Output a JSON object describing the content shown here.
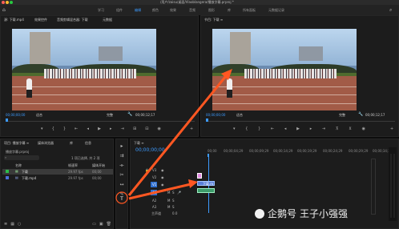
{
  "window": {
    "title": "/用户/zaisu/桌面/Vlaoblangera/播放字幕.prproj *"
  },
  "workspaces": [
    "学习",
    "组件",
    "编辑",
    "颜色",
    "效果",
    "音频",
    "图形",
    "库",
    "所有面板",
    "元数据记录"
  ],
  "source_panel": {
    "tabs": [
      "源: 下载.mp4",
      "效果控件",
      "音频剪辑混合器: 下载",
      "元数据"
    ],
    "timecode": "00;00;00;00",
    "fit": "适合",
    "quality": "完整",
    "duration": "00;00;12;17"
  },
  "program_panel": {
    "tab": "节目: 下载 ≡",
    "timecode": "00;00;00;00",
    "fit": "适合",
    "quality": "完整",
    "duration": "00;00;12;17"
  },
  "project_panel": {
    "tabs": [
      "项目: 播放字幕 ≡",
      "媒体浏览器",
      "库",
      "信息"
    ],
    "project_file": "播放字幕.prproj",
    "count": "1 项已选择, 共 2 项",
    "columns": [
      "名称",
      "帧速率",
      "媒体开始"
    ],
    "items": [
      {
        "name": "下载",
        "fps": "29.97 fps",
        "start": "00;00",
        "color": "#2bbd4a"
      },
      {
        "name": "下载.mp4",
        "fps": "29.97 fps",
        "start": "00;00",
        "color": "#4c6fd8"
      }
    ]
  },
  "timeline": {
    "tab": "下载 ≡",
    "timecode": "00;00;00;00",
    "ruler": [
      "00;00",
      "00;00;04;29",
      "00;00;09;29",
      "00;00;14;29",
      "00;00;19;29",
      "00;00;24;29",
      "00;00;29;29",
      "00;00;34;28"
    ],
    "tracks": [
      "V3",
      "V2",
      "V1",
      "A1",
      "A2",
      "A3"
    ],
    "clip_label": "下载.m",
    "master": "主声道",
    "master_value": "0.0"
  },
  "watermark": {
    "prefix": "企鹅号",
    "name": "王子小强强"
  },
  "colors": {
    "accent": "#3d9bff",
    "annotation": "#ff5722",
    "clip_video": "#5a7fd8",
    "clip_audio": "#3d9b6a",
    "title_clip": "#e48be4"
  }
}
